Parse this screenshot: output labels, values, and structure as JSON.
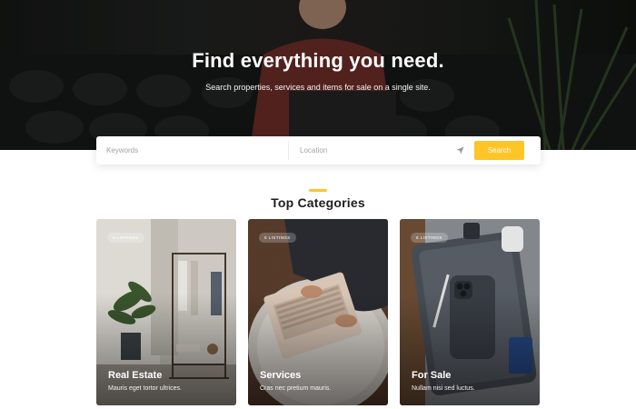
{
  "hero": {
    "title": "Find everything you need.",
    "subtitle": "Search properties, services and items for sale on a single site."
  },
  "search": {
    "keywords_placeholder": "Keywords",
    "location_placeholder": "Location",
    "locate_icon": "navigation-arrow-icon",
    "button_label": "Search"
  },
  "categories": {
    "title": "Top Categories",
    "accent_color": "#ffc527",
    "items": [
      {
        "badge": "6 LISTINGS",
        "name": "Real Estate",
        "description": "Mauris eget tortor ultrices."
      },
      {
        "badge": "6 LISTINGS",
        "name": "Services",
        "description": "Cras nec pretium mauris."
      },
      {
        "badge": "6 LISTINGS",
        "name": "For Sale",
        "description": "Nullam nisi sed luctus."
      }
    ]
  }
}
